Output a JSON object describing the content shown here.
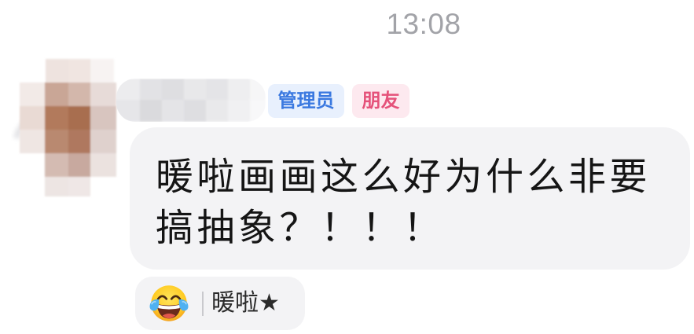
{
  "timestamp": "13:08",
  "sender": {
    "avatar_icon": "blurred-avatar-icon",
    "badges": [
      {
        "label": "管理员",
        "color": "#3b79e0",
        "background": "#e8f0fd"
      },
      {
        "label": "朋友",
        "color": "#e5527a",
        "background": "#fde9ef"
      }
    ]
  },
  "message": {
    "text": "暖啦画画这么好为什么非要搞抽象？！！！"
  },
  "reaction": {
    "icon": "face-with-tears-of-joy-icon",
    "user": "暖啦★"
  },
  "colors": {
    "timestamp": "#a2a3a8",
    "bubble": "#f3f3f5",
    "text": "#151515"
  }
}
